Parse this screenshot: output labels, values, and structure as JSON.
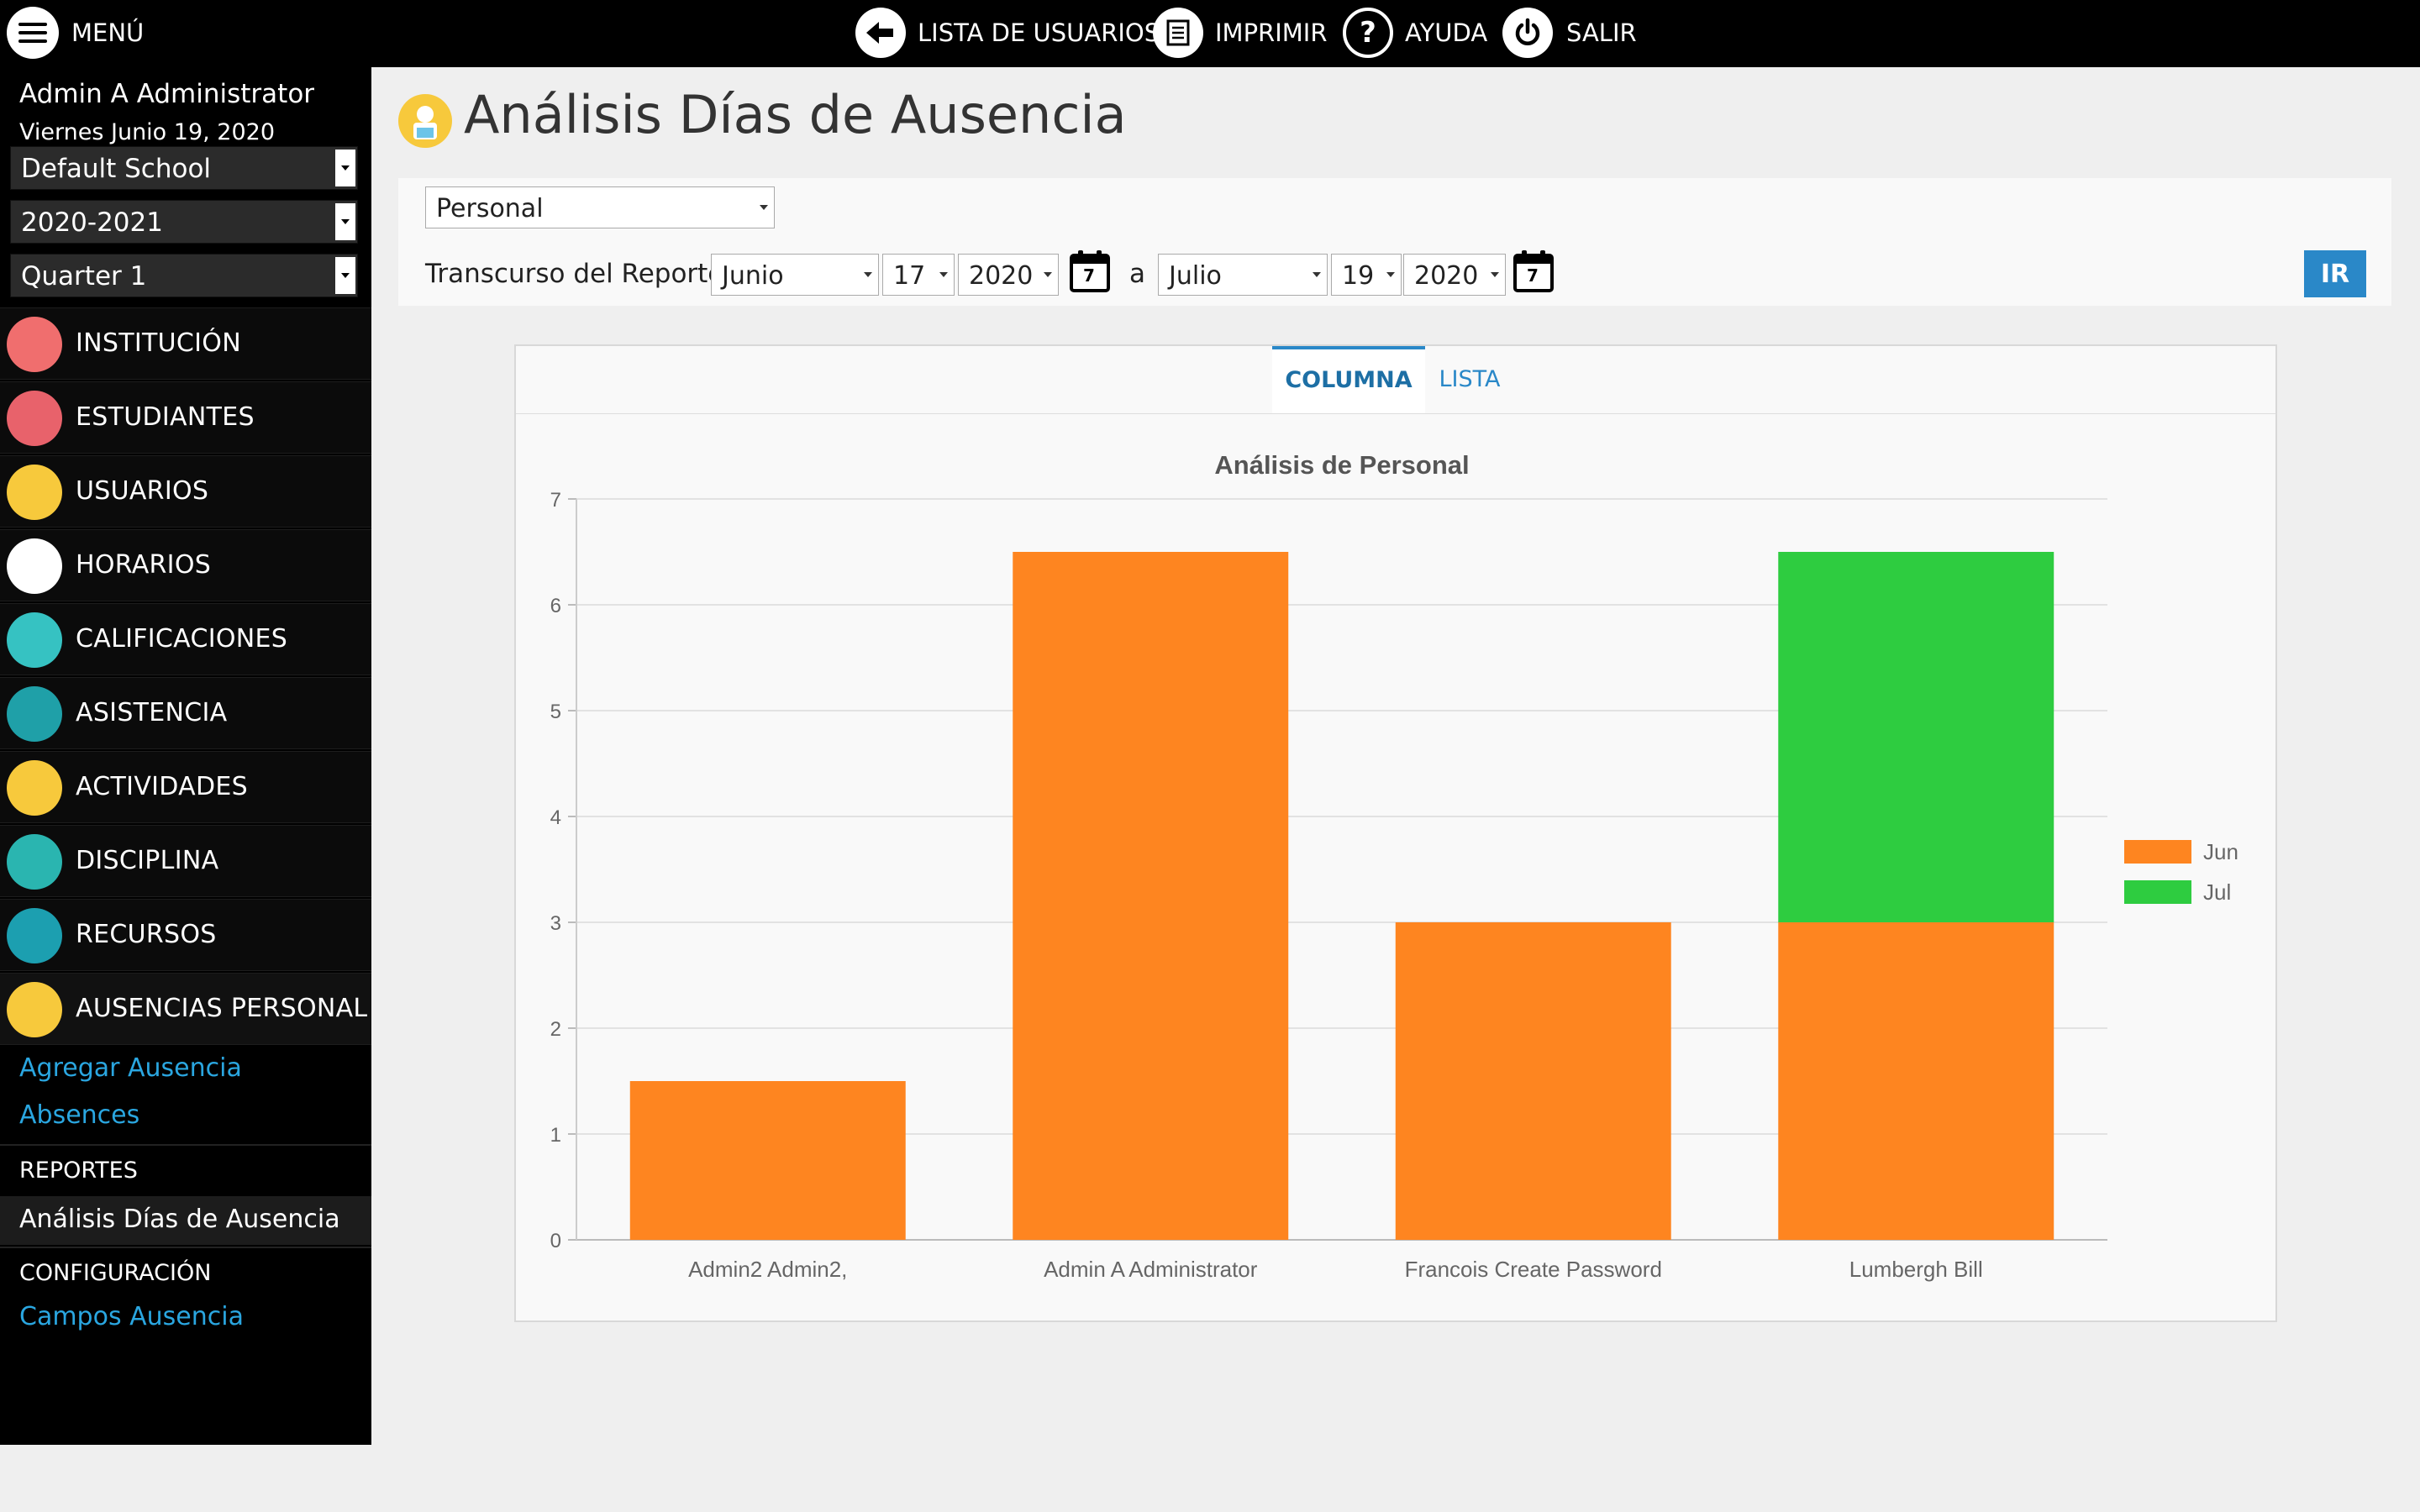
{
  "topbar": {
    "menu_label": "MENÚ",
    "user_list_label": "LISTA DE USUARIOS",
    "print_label": "IMPRIMIR",
    "help_label": "AYUDA",
    "exit_label": "SALIR"
  },
  "sidebar": {
    "user_name": "Admin A Administrator",
    "date": "Viernes Junio 19, 2020",
    "school": "Default School",
    "year": "2020-2021",
    "quarter": "Quarter 1",
    "items": [
      {
        "label": "INSTITUCIÓN",
        "icon": "school-icon",
        "color": "#f06e6e"
      },
      {
        "label": "ESTUDIANTES",
        "icon": "students-icon",
        "color": "#e8626b"
      },
      {
        "label": "USUARIOS",
        "icon": "users-icon",
        "color": "#f7c93c"
      },
      {
        "label": "HORARIOS",
        "icon": "schedule-icon",
        "color": "#ffffff"
      },
      {
        "label": "CALIFICACIONES",
        "icon": "grades-icon",
        "color": "#36c2c2"
      },
      {
        "label": "ASISTENCIA",
        "icon": "attendance-icon",
        "color": "#1fa0a8"
      },
      {
        "label": "ACTIVIDADES",
        "icon": "activities-icon",
        "color": "#f7c93c"
      },
      {
        "label": "DISCIPLINA",
        "icon": "discipline-icon",
        "color": "#2ab5b0"
      },
      {
        "label": "RECURSOS",
        "icon": "resources-icon",
        "color": "#1c9fb0"
      },
      {
        "label": "AUSENCIAS PERSONAL",
        "icon": "staff-absences-icon",
        "color": "#f7c93c"
      }
    ],
    "sub_links": {
      "add_absence": "Agregar Ausencia",
      "absences": "Absences",
      "reports_header": "REPORTES",
      "current_report": "Análisis Días de Ausencia",
      "config_header": "CONFIGURACIÓN",
      "absence_fields": "Campos Ausencia"
    }
  },
  "main": {
    "title": "Análisis Días de Ausencia",
    "type_select": "Personal",
    "range_label": "Transcurso del Reporte:",
    "from": {
      "month": "Junio",
      "day": "17",
      "year": "2020"
    },
    "to_label": "a",
    "to": {
      "month": "Julio",
      "day": "19",
      "year": "2020"
    },
    "calendar_day": "7",
    "go_label": "IR",
    "tabs": {
      "column": "COLUMNA",
      "list": "LISTA"
    }
  },
  "colors": {
    "accent": "#2a88c8",
    "link": "#2aa6e0",
    "jun": "#fe8520",
    "jul": "#2ecc40"
  },
  "chart_data": {
    "type": "bar",
    "stacked": true,
    "title": "Análisis de Personal",
    "categories": [
      "Admin2 Admin2,",
      "Admin A Administrator",
      "Francois Create Password",
      "Lumbergh Bill"
    ],
    "series": [
      {
        "name": "Jun",
        "color": "#fe8520",
        "values": [
          1.5,
          6.5,
          3,
          3
        ]
      },
      {
        "name": "Jul",
        "color": "#2ecc40",
        "values": [
          0,
          0,
          0,
          3.5
        ]
      }
    ],
    "ylim": [
      0,
      7
    ],
    "yticks": [
      "0",
      "1",
      "2",
      "3",
      "4",
      "5",
      "6",
      "7"
    ],
    "grid": true,
    "legend": "right"
  }
}
